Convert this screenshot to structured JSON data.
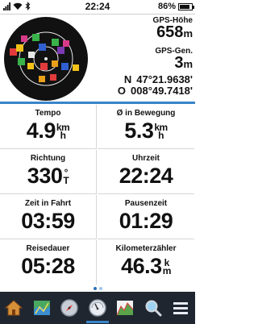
{
  "status_bar": {
    "time": "22:24",
    "battery": "86%",
    "battery_level": 0.86,
    "icons": [
      "wifi-icon",
      "bluetooth-icon",
      "signal-icon",
      "battery-icon"
    ]
  },
  "satellites": {
    "gps_height_label": "GPS-Höhe",
    "gps_height_value": "658",
    "gps_height_unit": "m",
    "gps_accuracy_label": "GPS-Gen.",
    "gps_accuracy_value": "3",
    "gps_accuracy_unit": "m",
    "lat_dir": "N",
    "lat": "47°21.9638'",
    "lon_dir": "O",
    "lon": "008°49.7418'"
  },
  "fields": [
    {
      "label": "Tempo",
      "value": "4.9",
      "unit_top": "km",
      "unit_bottom": "h"
    },
    {
      "label": "Ø in Bewegung",
      "value": "5.3",
      "unit_top": "km",
      "unit_bottom": "h"
    },
    {
      "label": "Richtung",
      "value": "330",
      "unit_top": "°",
      "unit_bottom": "T"
    },
    {
      "label": "Uhrzeit",
      "value": "22:24",
      "unit_top": "",
      "unit_bottom": ""
    },
    {
      "label": "Zeit in Fahrt",
      "value": "03:59",
      "unit_top": "",
      "unit_bottom": ""
    },
    {
      "label": "Pausenzeit",
      "value": "01:29",
      "unit_top": "",
      "unit_bottom": ""
    },
    {
      "label": "Reisedauer",
      "value": "05:28",
      "unit_top": "",
      "unit_bottom": ""
    },
    {
      "label": "Kilometerzähler",
      "value": "46.3",
      "unit_top": "k",
      "unit_bottom": "m"
    }
  ],
  "pages": {
    "count": 2,
    "active": 1
  },
  "bottom_bar": {
    "buttons": [
      "home-icon",
      "map-icon",
      "compass-icon",
      "trip-computer-icon",
      "elevation-plot-icon",
      "search-icon",
      "menu-icon"
    ],
    "active_index": 3,
    "accent": "#3a84c9",
    "background": "#1f2630"
  }
}
